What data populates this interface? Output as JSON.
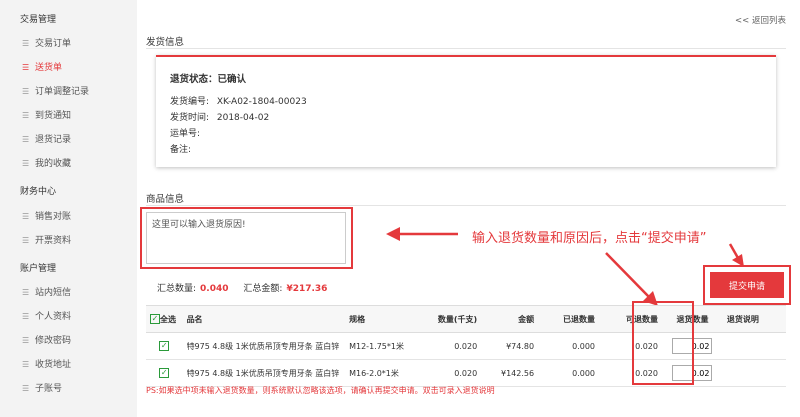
{
  "sidebar": {
    "sections": [
      {
        "title": "交易管理",
        "items": [
          "交易订单",
          "送货单",
          "订单调整记录",
          "到货通知",
          "退货记录",
          "我的收藏"
        ]
      },
      {
        "title": "财务中心",
        "items": [
          "销售对账",
          "开票资料"
        ]
      },
      {
        "title": "账户管理",
        "items": [
          "站内短信",
          "个人资料",
          "修改密码",
          "收货地址",
          "子账号"
        ]
      }
    ],
    "active_item": "送货单"
  },
  "back_link": "<< 返回列表",
  "shipping": {
    "heading": "发货信息",
    "status_label": "退货状态：",
    "status_value": "已确认",
    "fields": [
      {
        "label": "发货编号:",
        "value": "XK-A02-1804-00023"
      },
      {
        "label": "发货时间:",
        "value": "2018-04-02"
      },
      {
        "label": "运单号:",
        "value": ""
      },
      {
        "label": "备注:",
        "value": ""
      }
    ]
  },
  "goods": {
    "heading": "商品信息",
    "reason_placeholder": "这里可以输入退货原因!",
    "callout": "输入退货数量和原因后，点击“提交申请”",
    "total_qty_label": "汇总数量:",
    "total_qty": "0.040",
    "total_amount_label": "汇总金额:",
    "total_amount": "¥217.36",
    "submit_label": "提交申请"
  },
  "table": {
    "select_all": "全选",
    "headers": [
      "品名",
      "规格",
      "数量(千支)",
      "金额",
      "已退数量",
      "可退数量",
      "退货数量",
      "退货说明"
    ],
    "rows": [
      {
        "name": "特975 4.8级 1米优质吊顶专用牙条 蓝白锌",
        "spec": "M12-1.75*1米",
        "qty": "0.020",
        "amount": "¥74.80",
        "returned": "0.000",
        "returnable": "0.020",
        "return_qty": "0.02",
        "note": ""
      },
      {
        "name": "特975 4.8级 1米优质吊顶专用牙条 蓝白锌",
        "spec": "M16-2.0*1米",
        "qty": "0.020",
        "amount": "¥142.56",
        "returned": "0.000",
        "returnable": "0.020",
        "return_qty": "0.02",
        "note": ""
      }
    ]
  },
  "ps_note": "PS:如果选中项未输入退货数量，则系统默认忽略该选项，请确认再提交申请。双击可录入退货说明",
  "colors": {
    "accent": "#e4393c",
    "checkbox": "#2a9a3a",
    "sidebar_bg": "#f3f3f3"
  }
}
